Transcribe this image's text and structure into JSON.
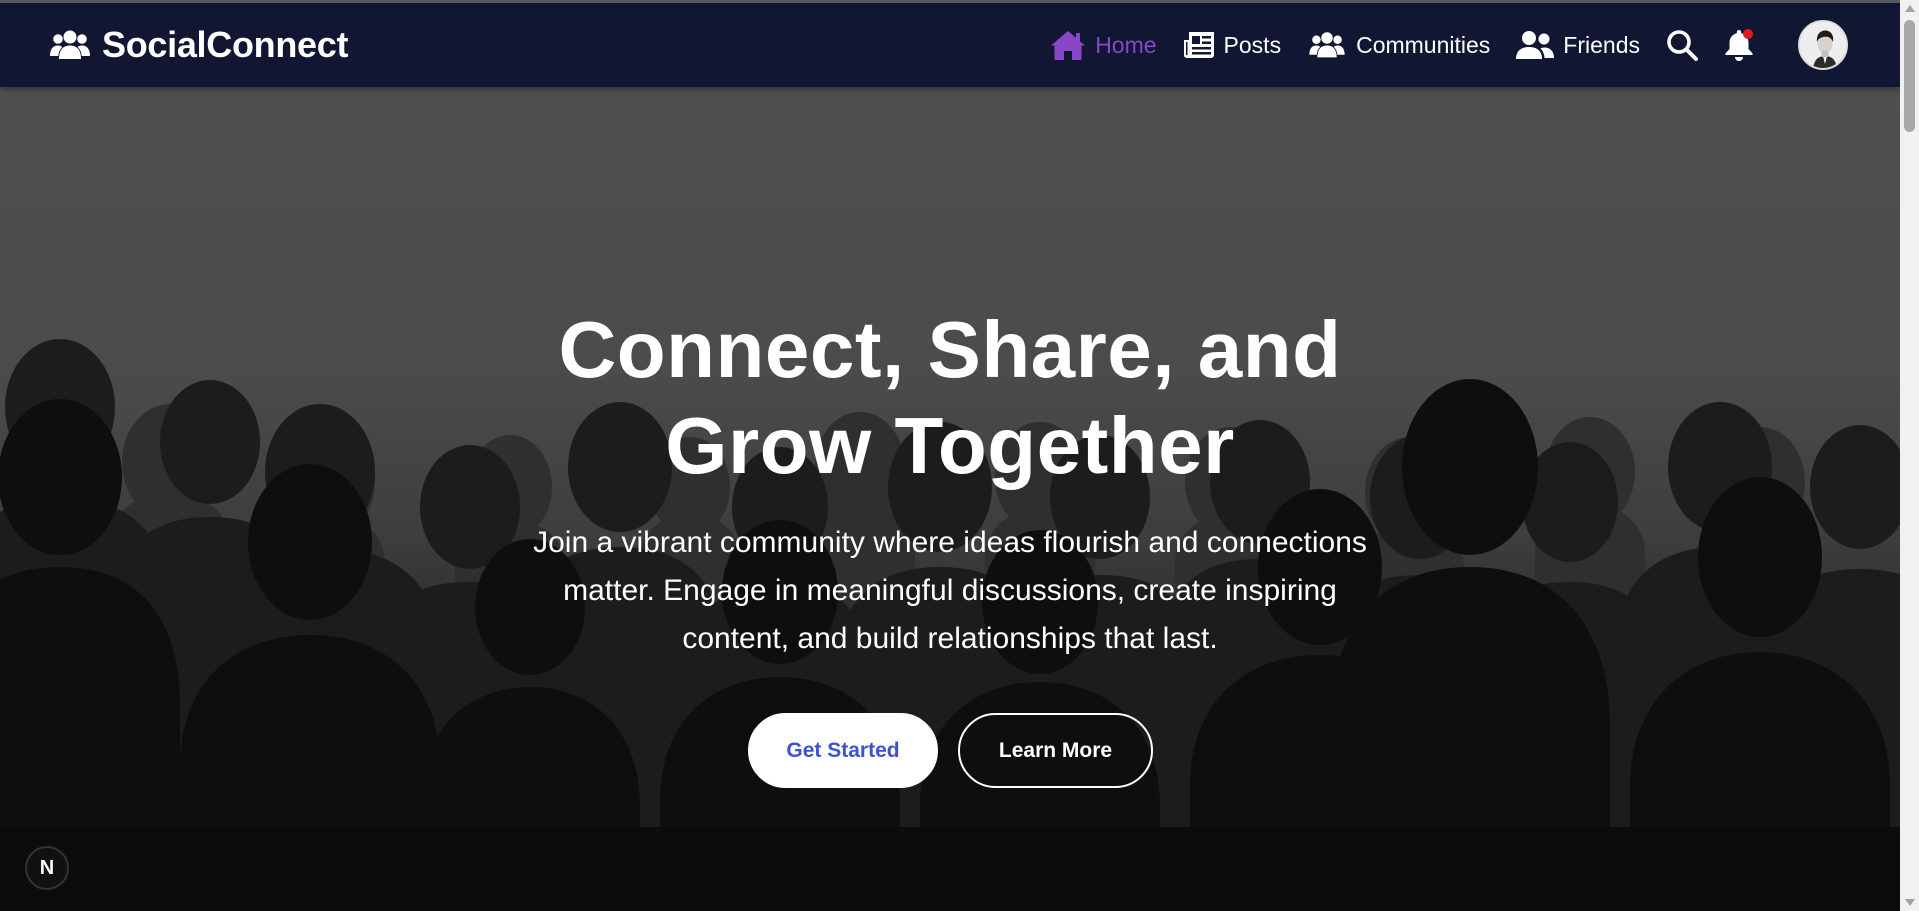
{
  "brand": {
    "name": "SocialConnect",
    "icon": "users-icon"
  },
  "nav": {
    "items": [
      {
        "label": "Home",
        "icon": "home-icon",
        "active": true
      },
      {
        "label": "Posts",
        "icon": "newspaper-icon",
        "active": false
      },
      {
        "label": "Communities",
        "icon": "users-icon",
        "active": false
      },
      {
        "label": "Friends",
        "icon": "user-friends-icon",
        "active": false
      }
    ],
    "search_icon": "search-icon",
    "notification_icon": "bell-icon",
    "avatar": "user-avatar"
  },
  "hero": {
    "title_line1": "Connect, Share, and",
    "title_line2": "Grow Together",
    "subtitle_line1": "Join a vibrant community where ideas flourish and connections",
    "subtitle_line2": "matter. Engage in meaningful discussions, create inspiring",
    "subtitle_line3": "content, and build relationships that last.",
    "primary_button": "Get Started",
    "secondary_button": "Learn More"
  },
  "dev_badge": {
    "label": "N"
  },
  "colors": {
    "navbar_bg": "#111633",
    "active_link": "#8a46c8",
    "primary_button_text": "#3b52d6",
    "notification_dot": "#e31b1b"
  }
}
